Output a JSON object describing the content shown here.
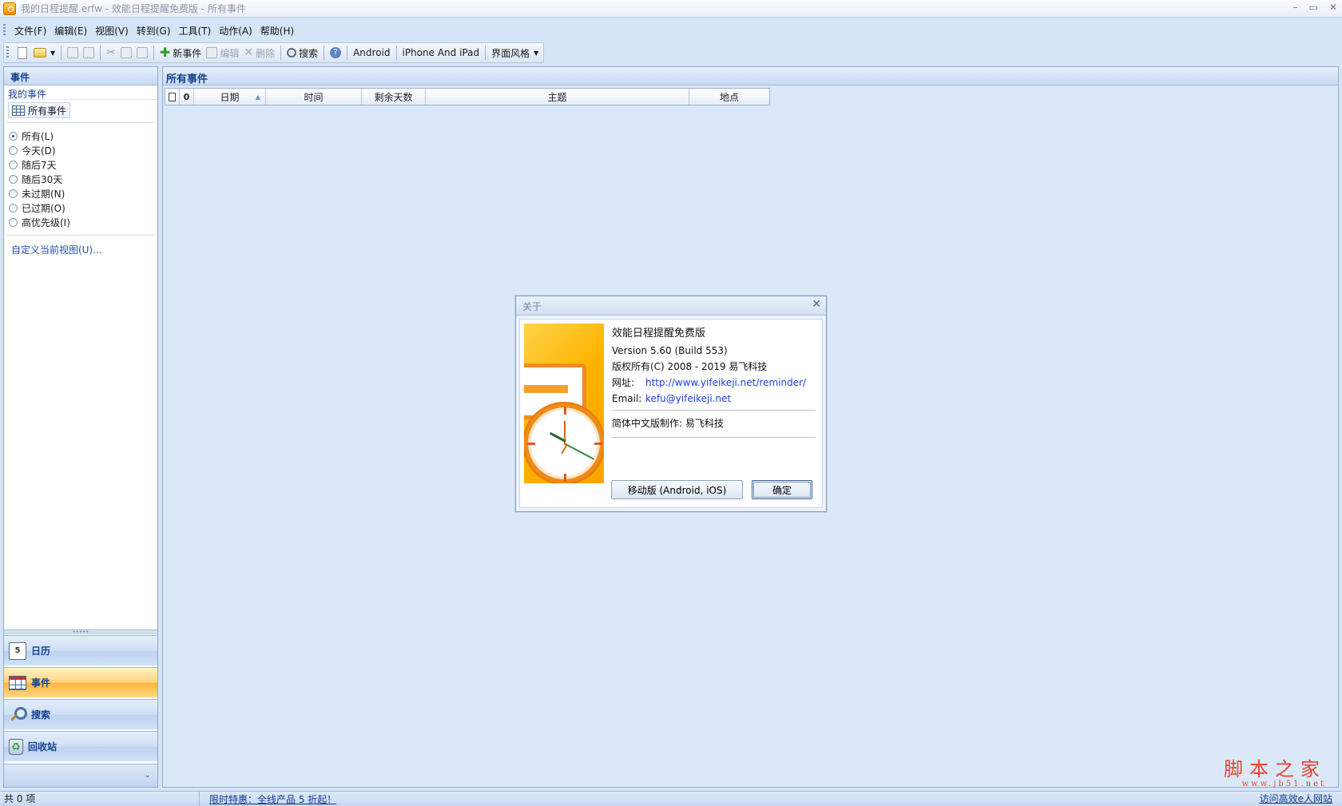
{
  "window": {
    "title": "我的日程提醒.erfw - 效能日程提醒免费版 - 所有事件",
    "controls": {
      "minimize": "–",
      "restore": "▭",
      "close": "✕"
    }
  },
  "menu": [
    "文件(F)",
    "编辑(E)",
    "视图(V)",
    "转到(G)",
    "工具(T)",
    "动作(A)",
    "帮助(H)"
  ],
  "toolbar": {
    "new_event": "新事件",
    "edit": "编辑",
    "delete": "删除",
    "search": "搜索",
    "android": "Android",
    "iphone": "iPhone And iPad",
    "theme": "界面风格"
  },
  "left_panel": {
    "header": "事件",
    "subheader": "我的事件",
    "all_events": "所有事件",
    "filters": [
      {
        "label": "所有(L)",
        "checked": true
      },
      {
        "label": "今天(D)",
        "checked": false
      },
      {
        "label": "随后7天",
        "checked": false
      },
      {
        "label": "随后30天",
        "checked": false
      },
      {
        "label": "未过期(N)",
        "checked": false
      },
      {
        "label": "已过期(O)",
        "checked": false
      },
      {
        "label": "高优先级(I)",
        "checked": false
      }
    ],
    "customize_link": "自定义当前视图(U)...",
    "nav": {
      "calendar": "日历",
      "calendar_day": "5",
      "events": "事件",
      "search": "搜索",
      "recycle": "回收站"
    }
  },
  "main_panel": {
    "header": "所有事件",
    "columns": [
      "日期",
      "时间",
      "剩余天数",
      "主题",
      "地点"
    ]
  },
  "about_dialog": {
    "title": "关于",
    "product_name": "效能日程提醒免费版",
    "version": "Version 5.60 (Build 553)",
    "copyright": "版权所有(C) 2008 - 2019 易飞科技",
    "website_label": "网址:",
    "website": "http://www.yifeikeji.net/reminder/",
    "email_label": "Email:",
    "email": "kefu@yifeikeji.net",
    "localization": "简体中文版制作:  易飞科技",
    "mobile_button": "移动版 (Android, iOS)",
    "ok_button": "确定"
  },
  "status_bar": {
    "count": "共 0 项",
    "promo": "限时特惠：全线产品 5 折起！",
    "right_link": "访问高效e人网站"
  },
  "watermark": {
    "text": "脚本之家",
    "url": "www.jb51.net"
  },
  "colors": {
    "accent_active_nav": "#ffb53e",
    "header_text": "#15428b",
    "link": "#1c3fd8",
    "background": "#dbe8f8"
  }
}
